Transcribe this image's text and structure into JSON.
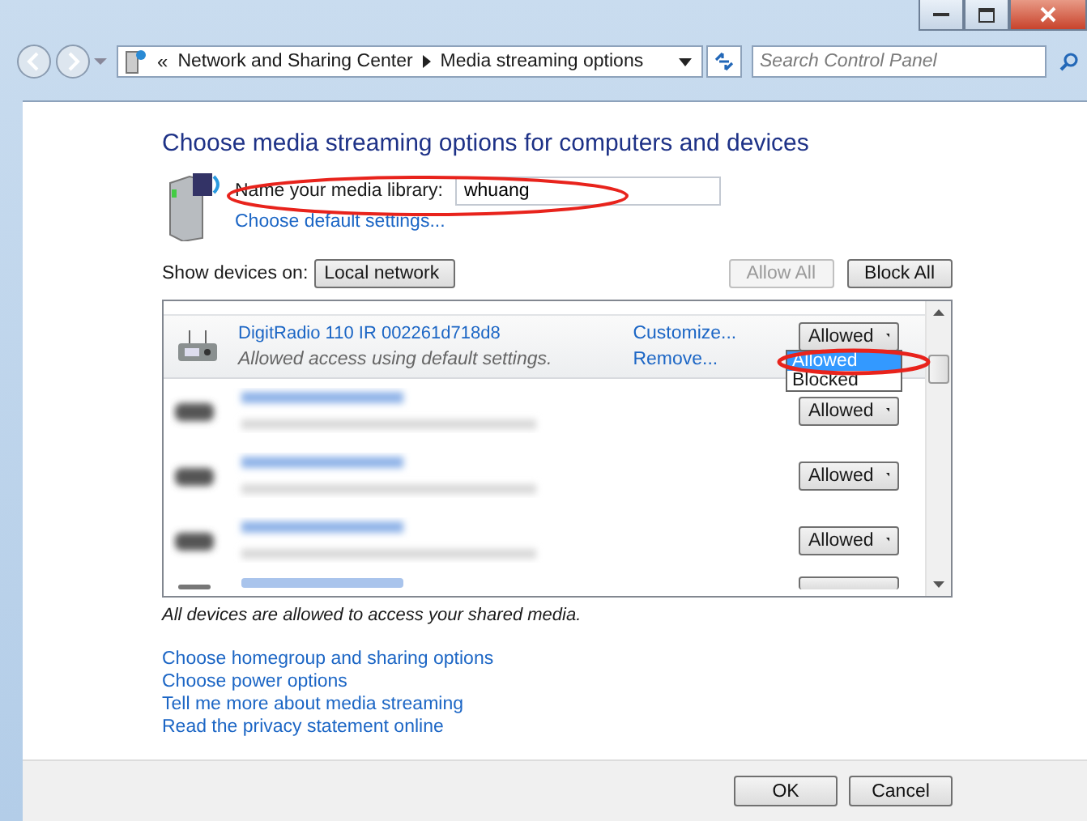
{
  "address_bar": {
    "chevron": "«",
    "crumbs": [
      "Network and Sharing Center",
      "Media streaming options"
    ]
  },
  "search": {
    "placeholder": "Search Control Panel"
  },
  "heading": "Choose media streaming options for computers and devices",
  "library": {
    "label": "Name your media library:",
    "value": "whuang",
    "highlighted": true,
    "link": "Choose default settings..."
  },
  "show_devices": {
    "label": "Show devices on:",
    "value": "Local network"
  },
  "buttons": [
    {
      "label": "Allow All",
      "disabled": true
    },
    {
      "label": "Block All",
      "disabled": false
    }
  ],
  "devices": [
    {
      "kind": "device",
      "name": "DigitRadio 110 IR 002261d718d8",
      "status": "Allowed access using default settings.",
      "links": [
        "Customize...",
        "Remove..."
      ],
      "access": "Allowed",
      "selected": true,
      "dropdown": {
        "highlighted": true,
        "options": [
          {
            "label": "Allowed",
            "selected": true
          },
          {
            "label": "Blocked",
            "selected": false
          }
        ]
      }
    },
    {
      "kind": "blurred",
      "access": "Allowed",
      "selected": false
    },
    {
      "kind": "blurred",
      "access": "Allowed",
      "selected": false
    },
    {
      "kind": "blurred",
      "access": "Allowed",
      "selected": false
    },
    {
      "kind": "partial",
      "selected": false
    }
  ],
  "note": "All devices are allowed to access your shared media.",
  "links": [
    "Choose homegroup and sharing options",
    "Choose power options",
    "Tell me more about media streaming",
    "Read the privacy statement online"
  ],
  "footer_buttons": [
    "OK",
    "Cancel"
  ]
}
